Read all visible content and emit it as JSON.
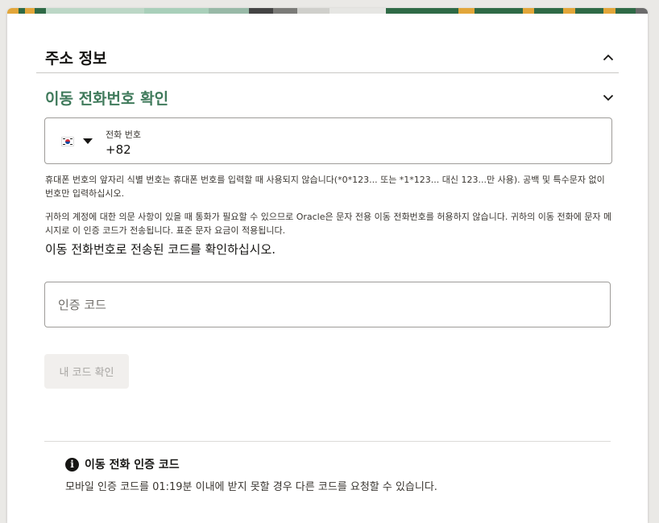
{
  "address_section": {
    "title": "주소 정보",
    "state": "expanded"
  },
  "phone_section": {
    "title": "이동 전화번호 확인",
    "state": "collapsed",
    "title_color": "#3f7a5b"
  },
  "phone_field": {
    "country_flag": "south-korea-flag-icon",
    "label": "전화 번호",
    "value": "+82"
  },
  "help": {
    "format_note": "휴대폰 번호의 앞자리 식별 번호는 휴대폰 번호를 입력할 때 사용되지 않습니다(*0*123... 또는 *1*123... 대신 123...만 사용). 공백 및 특수문자 없이 번호만 입력하십시오.",
    "sms_note": "귀하의 계정에 대한 의문 사항이 있을 때 통화가 필요할 수 있으므로 Oracle은 문자 전용 이동 전화번호를 허용하지 않습니다. 귀하의 이동 전화에 문자 메시지로 이 인증 코드가 전송됩니다. 표준 문자 요금이 적용됩니다."
  },
  "verification": {
    "instruction": "이동 전화번호로 전송된 코드를 확인하십시오.",
    "code_placeholder": "인증 코드",
    "code_value": "",
    "verify_button_label": "내 코드 확인"
  },
  "info": {
    "icon": "info-icon",
    "title": "이동 전화 인증 코드",
    "text": "모바일 인증 코드를 01:19분 이내에 받지 못할 경우 다른 코드를 요청할 수 있습니다."
  }
}
